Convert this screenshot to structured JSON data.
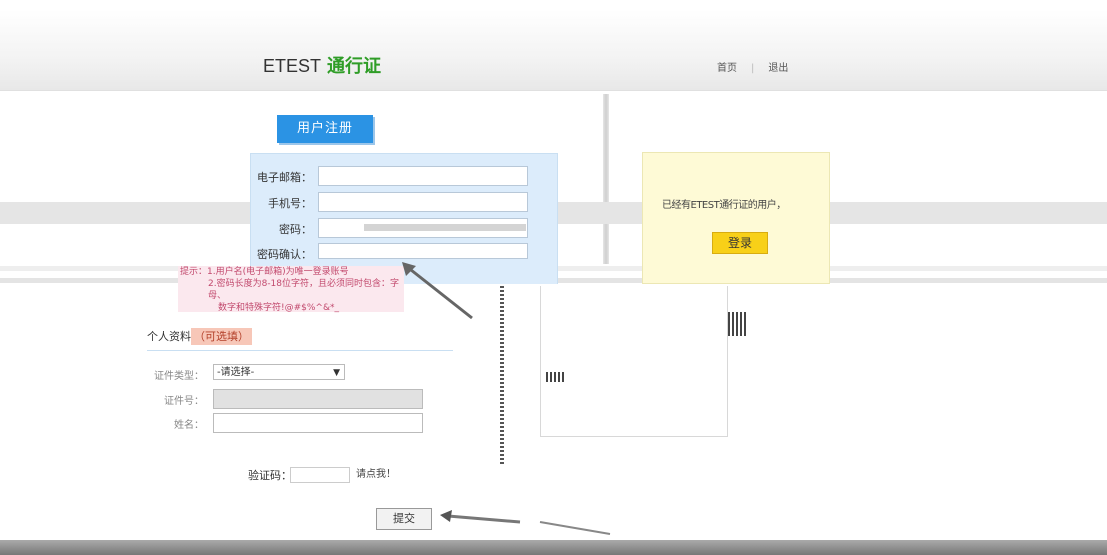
{
  "header": {
    "logo_prefix": "ETEST",
    "logo_highlight": "通行证",
    "nav": [
      {
        "label": "首页"
      },
      {
        "label": "退出"
      }
    ]
  },
  "register": {
    "title": "用户注册",
    "fields": [
      {
        "label": "电子邮箱：",
        "value": ""
      },
      {
        "label": "手机号：",
        "value": ""
      },
      {
        "label": "密码：",
        "value": ""
      },
      {
        "label": "密码确认：",
        "value": ""
      }
    ],
    "hint_lines": [
      "提示：1.用户名(电子邮箱)为唯一登录账号",
      "2.密码长度为8-18位字符，且必须同时包含：字母、",
      "数字和特殊字符!@#$%^&*_"
    ]
  },
  "sidebar": {
    "tip": "已经有ETEST通行证的用户，",
    "login_button": "登录"
  },
  "personal": {
    "heading": "个人资料",
    "optional": "（可选填）",
    "fields": [
      {
        "label": "证件类型：",
        "value": "-请选择-"
      },
      {
        "label": "证件号：",
        "value": ""
      },
      {
        "label": "姓名：",
        "value": ""
      }
    ]
  },
  "captcha": {
    "label": "验证码：",
    "refresh_text": "请点我！"
  },
  "submit_label": "提交",
  "colors": {
    "accent_blue": "#2b93e4",
    "brand_green": "#2f9d27",
    "login_yellow": "#f8d018",
    "form_bg": "#dcecfb",
    "hint_pink": "#fbe8ee"
  }
}
